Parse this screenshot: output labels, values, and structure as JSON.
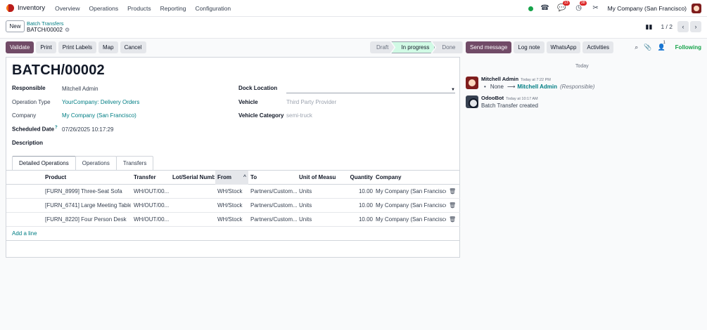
{
  "navbar": {
    "app_name": "Inventory",
    "menu": [
      "Overview",
      "Operations",
      "Products",
      "Reporting",
      "Configuration"
    ],
    "messages_badge": "13",
    "activities_badge": "38",
    "company": "My Company (San Francisco)"
  },
  "control": {
    "new_label": "New",
    "breadcrumb_parent": "Batch Transfers",
    "breadcrumb_current": "BATCH/00002",
    "pager": "1 / 2"
  },
  "toolbar": {
    "validate": "Validate",
    "print": "Print",
    "print_labels": "Print Labels",
    "map": "Map",
    "cancel": "Cancel"
  },
  "statusbar": {
    "steps": [
      "Draft",
      "In progress",
      "Done"
    ],
    "active": "In progress"
  },
  "form": {
    "title": "BATCH/00002",
    "responsible_label": "Responsible",
    "responsible": "Mitchell Admin",
    "operation_type_label": "Operation Type",
    "operation_type": "YourCompany: Delivery Orders",
    "company_label": "Company",
    "company": "My Company (San Francisco)",
    "scheduled_date_label": "Scheduled Date",
    "scheduled_date_help": "?",
    "scheduled_date": "07/26/2025 10:17:29",
    "description_label": "Description",
    "dock_location_label": "Dock Location",
    "dock_location": "",
    "vehicle_label": "Vehicle",
    "vehicle_placeholder": "Third Party Provider",
    "vehicle_category_label": "Vehicle Category",
    "vehicle_category_placeholder": "semi-truck"
  },
  "tabs": [
    "Detailed Operations",
    "Operations",
    "Transfers"
  ],
  "table": {
    "columns": [
      "Product",
      "Transfer",
      "Lot/Serial Number",
      "From",
      "To",
      "Unit of Measure",
      "Quantity",
      "Company"
    ],
    "rows": [
      [
        "[FURN_8999] Three-Seat Sofa",
        "WH/OUT/00...",
        "",
        "WH/Stock",
        "Partners/Custom...",
        "Units",
        "10.00",
        "My Company (San Francisco)"
      ],
      [
        "[FURN_6741] Large Meeting Table",
        "WH/OUT/00...",
        "",
        "WH/Stock",
        "Partners/Custom...",
        "Units",
        "10.00",
        "My Company (San Francisco)"
      ],
      [
        "[FURN_8220] Four Person Desk",
        "WH/OUT/00...",
        "",
        "WH/Stock",
        "Partners/Custom...",
        "Units",
        "10.00",
        "My Company (San Francisco)"
      ]
    ],
    "add_line": "Add a line"
  },
  "chatter": {
    "send_message": "Send message",
    "log_note": "Log note",
    "whatsapp": "WhatsApp",
    "activities": "Activities",
    "followers_count": "1",
    "following": "Following",
    "today": "Today",
    "messages": [
      {
        "author": "Mitchell Admin",
        "time": "Today at 7:22 PM",
        "old_value": "None",
        "new_value": "Mitchell Admin",
        "field": "(Responsible)"
      },
      {
        "author": "OdooBot",
        "time": "Today at 10:17 AM",
        "body": "Batch Transfer created"
      }
    ]
  },
  "colors": {
    "primary": "#714b67",
    "link": "#017e84",
    "following": "#16a34a",
    "badge": "#dc2626"
  }
}
